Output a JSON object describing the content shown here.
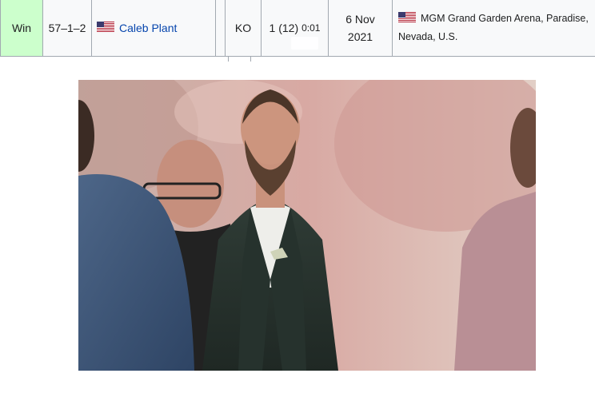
{
  "fight_row": {
    "result": "Win",
    "record": "57–1–2",
    "opponent": "Caleb Plant",
    "type": "KO",
    "round": "1 (12)",
    "time": "0:01",
    "date_line1": "6 Nov",
    "date_line2": "2021",
    "location_line1": "MGM Grand Garden Arena, Paradise,",
    "location_line2": "Nevada, U.S.",
    "flag_icon": "us-flag-icon",
    "colors": {
      "win_bg": "#ccffcc",
      "cell_bg": "#f8f9fa",
      "border": "#a2a9b1",
      "link": "#0645ad"
    }
  },
  "photo": {
    "icons": [
      "press-conference-photo"
    ]
  }
}
